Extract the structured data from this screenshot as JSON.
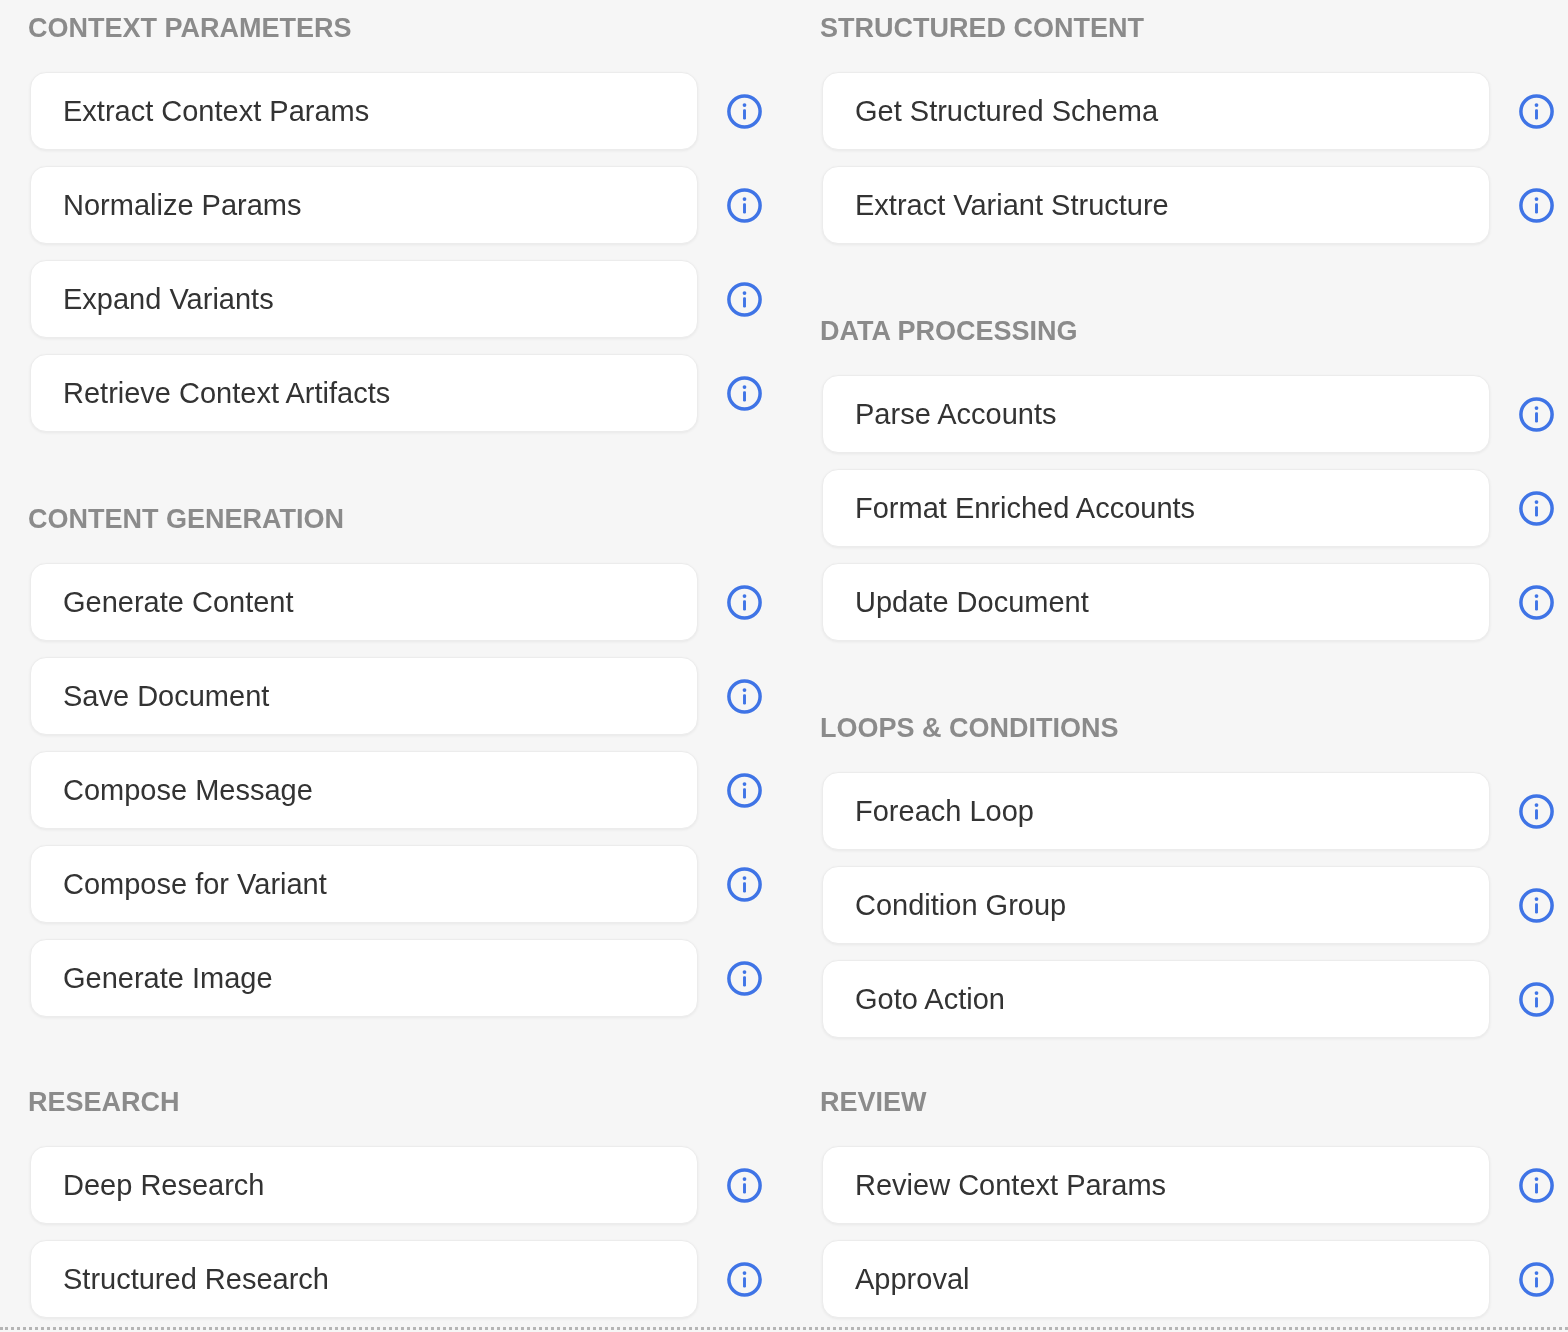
{
  "rows": [
    {
      "left": [
        {
          "title": "CONTEXT PARAMETERS",
          "items": [
            "Extract Context Params",
            "Normalize Params",
            "Expand Variants",
            "Retrieve Context Artifacts"
          ]
        },
        {
          "title": "CONTENT GENERATION",
          "items": [
            "Generate Content",
            "Save Document",
            "Compose Message",
            "Compose for Variant",
            "Generate Image"
          ]
        }
      ],
      "right": [
        {
          "title": "STRUCTURED CONTENT",
          "items": [
            "Get Structured Schema",
            "Extract Variant Structure"
          ]
        },
        {
          "title": "DATA PROCESSING",
          "items": [
            "Parse Accounts",
            "Format Enriched Accounts",
            "Update Document"
          ]
        },
        {
          "title": "LOOPS & CONDITIONS",
          "items": [
            "Foreach Loop",
            "Condition Group",
            "Goto Action"
          ]
        }
      ]
    },
    {
      "left": [
        {
          "title": "RESEARCH",
          "items": [
            "Deep Research",
            "Structured Research"
          ]
        }
      ],
      "right": [
        {
          "title": "REVIEW",
          "items": [
            "Review Context Params",
            "Approval"
          ]
        }
      ]
    }
  ]
}
